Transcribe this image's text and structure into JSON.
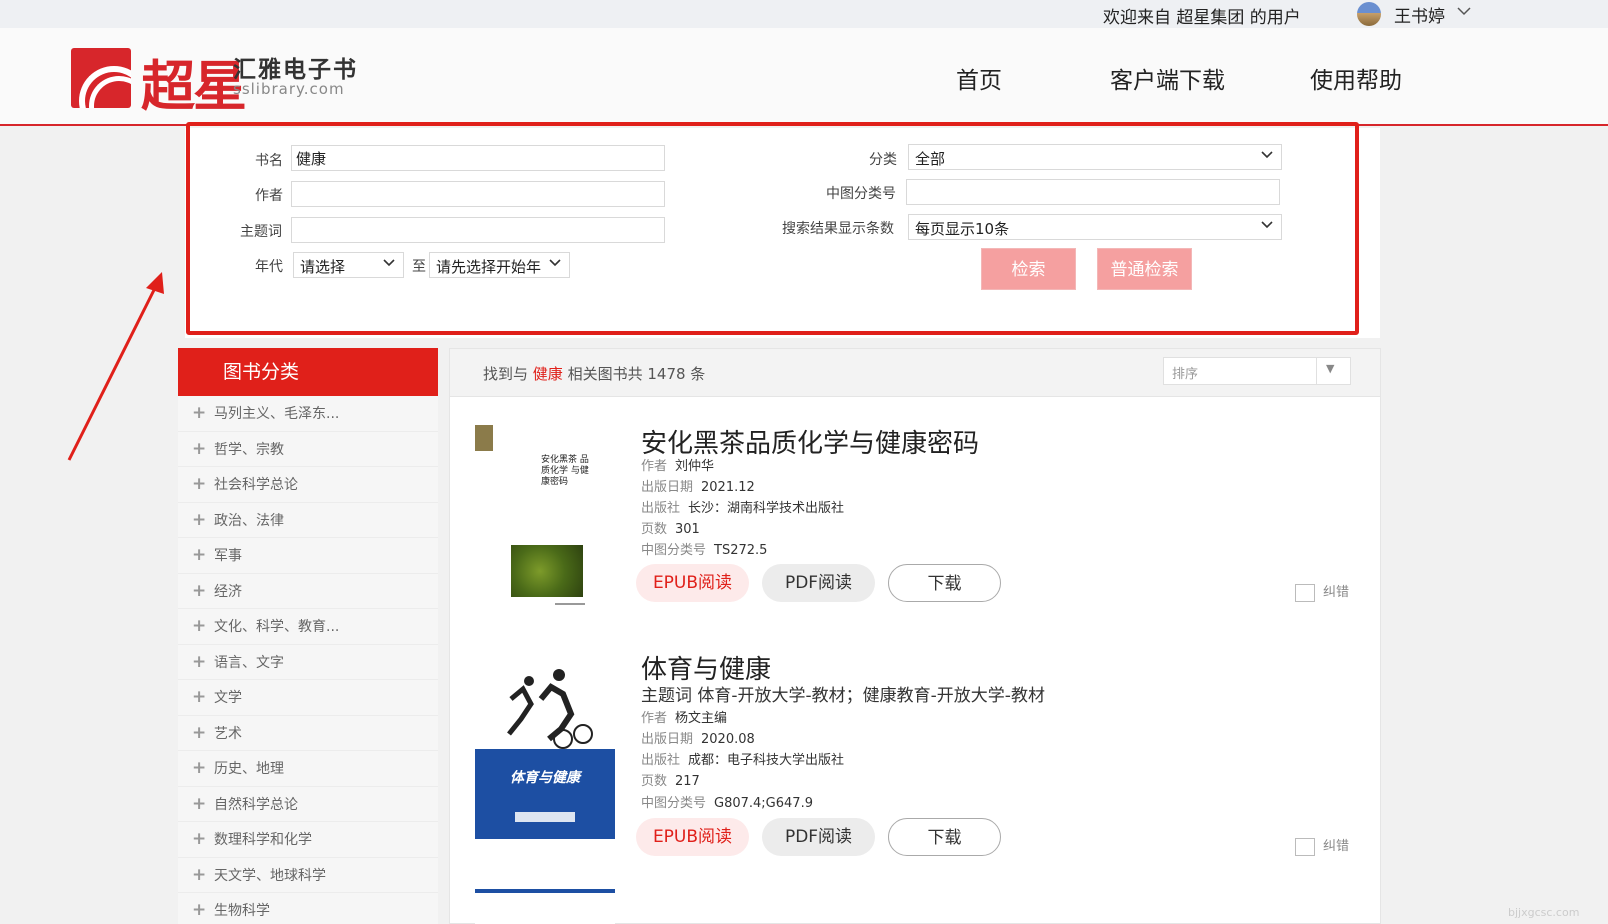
{
  "topbar": {
    "welcome": "欢迎来自 超星集团 的用户",
    "username": "王书婷",
    "chevron_icon": "chevron-down-icon"
  },
  "header": {
    "logo_script": "超星",
    "logo_title": "汇雅电子书",
    "logo_sub": "sslibrary.com",
    "nav": [
      "首页",
      "客户端下载",
      "使用帮助"
    ],
    "accent_color": "#e0201a"
  },
  "search": {
    "title_label": "书名",
    "title_value": "健康",
    "author_label": "作者",
    "author_value": "",
    "subject_label": "主题词",
    "subject_value": "",
    "year_label": "年代",
    "year_from": "请选择",
    "year_to_label": "至",
    "year_to": "请先选择开始年",
    "category_label": "分类",
    "category_value": "全部",
    "clc_label": "中图分类号",
    "clc_value": "",
    "page_size_label": "搜索结果显示条数",
    "page_size_value": "每页显示10条",
    "search_button": "检索",
    "basic_search_button": "普通检索"
  },
  "sidebar": {
    "title": "图书分类",
    "categories": [
      "马列主义、毛泽东...",
      "哲学、宗教",
      "社会科学总论",
      "政治、法律",
      "军事",
      "经济",
      "文化、科学、教育...",
      "语言、文字",
      "文学",
      "艺术",
      "历史、地理",
      "自然科学总论",
      "数理科学和化学",
      "天文学、地球科学",
      "生物科学"
    ]
  },
  "results": {
    "summary_prefix": "找到与",
    "keyword": "健康",
    "summary_suffix": "相关图书共 1478 条",
    "sort_placeholder": "排序",
    "books": [
      {
        "title": "安化黑茶品质化学与健康密码",
        "author_label": "作者",
        "author": "刘仲华",
        "date_label": "出版日期",
        "date": "2021.12",
        "publisher_label": "出版社",
        "publisher": "长沙：湖南科学技术出版社",
        "pages_label": "页数",
        "pages": "301",
        "clc_label": "中图分类号",
        "clc": "TS272.5",
        "cover_text": "安化黑茶 品质化学 与健康密码"
      },
      {
        "title": "体育与健康",
        "subject_label": "主题词",
        "subject": "体育-开放大学-教材；健康教育-开放大学-教材",
        "author_label": "作者",
        "author": "杨文主编",
        "date_label": "出版日期",
        "date": "2020.08",
        "publisher_label": "出版社",
        "publisher": "成都：电子科技大学出版社",
        "pages_label": "页数",
        "pages": "217",
        "clc_label": "中图分类号",
        "clc": "G807.4;G647.9",
        "cover_text": "体育与健康"
      }
    ],
    "epub_label": "EPUB阅读",
    "pdf_label": "PDF阅读",
    "download_label": "下载",
    "report_label": "纠错"
  },
  "watermark": "bjjxgcsc.com"
}
